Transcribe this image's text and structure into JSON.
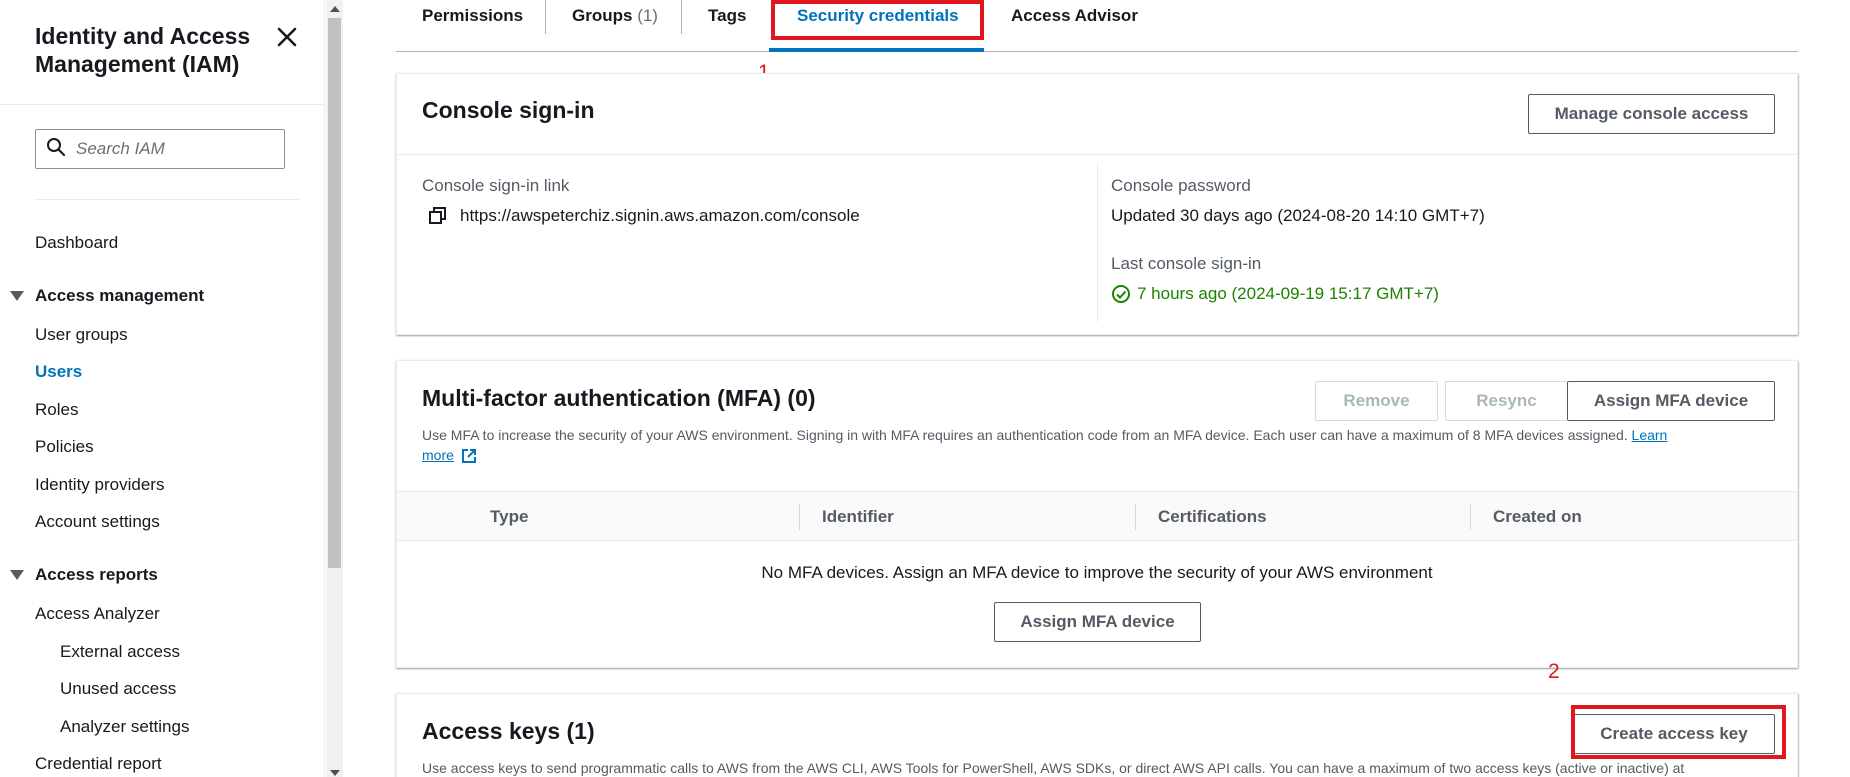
{
  "sidebar": {
    "title": "Identity and Access Management (IAM)",
    "search_placeholder": "Search IAM",
    "dashboard": "Dashboard",
    "access_management": {
      "label": "Access management",
      "items": [
        "User groups",
        "Users",
        "Roles",
        "Policies",
        "Identity providers",
        "Account settings"
      ],
      "active": "Users"
    },
    "access_reports": {
      "label": "Access reports",
      "items": [
        "Access Analyzer",
        "External access",
        "Unused access",
        "Analyzer settings",
        "Credential report"
      ]
    }
  },
  "tabs": [
    {
      "label": "Permissions"
    },
    {
      "label": "Groups",
      "count": "(1)"
    },
    {
      "label": "Tags"
    },
    {
      "label": "Security credentials",
      "active": true
    },
    {
      "label": "Access Advisor"
    }
  ],
  "annotations": {
    "marker1": "1",
    "marker2": "2",
    "color": "#e0171f"
  },
  "console_signin": {
    "title": "Console sign-in",
    "manage_button": "Manage console access",
    "link_label": "Console sign-in link",
    "link_value": "https://awspeterchiz.signin.aws.amazon.com/console",
    "password_label": "Console password",
    "password_value": "Updated 30 days ago (2024-08-20 14:10 GMT+7)",
    "last_signin_label": "Last console sign-in",
    "last_signin_value": "7 hours ago (2024-09-19 15:17 GMT+7)"
  },
  "mfa": {
    "title": "Multi-factor authentication (MFA) (0)",
    "remove_button": "Remove",
    "resync_button": "Resync",
    "assign_button": "Assign MFA device",
    "description": "Use MFA to increase the security of your AWS environment. Signing in with MFA requires an authentication code from an MFA device. Each user can have a maximum of 8 MFA devices assigned.",
    "learn_more_1": "Learn",
    "learn_more_2": "more",
    "columns": [
      "Type",
      "Identifier",
      "Certifications",
      "Created on"
    ],
    "empty_text": "No MFA devices. Assign an MFA device to improve the security of your AWS environment",
    "empty_assign_button": "Assign MFA device"
  },
  "access_keys": {
    "title": "Access keys (1)",
    "create_button": "Create access key",
    "description": "Use access keys to send programmatic calls to AWS from the AWS CLI, AWS Tools for PowerShell, AWS SDKs, or direct AWS API calls. You can have a maximum of two access keys (active or inactive) at"
  },
  "colors": {
    "accent": "#0073bb",
    "success": "#1d8102",
    "text": "#16191f",
    "muted": "#545b64"
  }
}
